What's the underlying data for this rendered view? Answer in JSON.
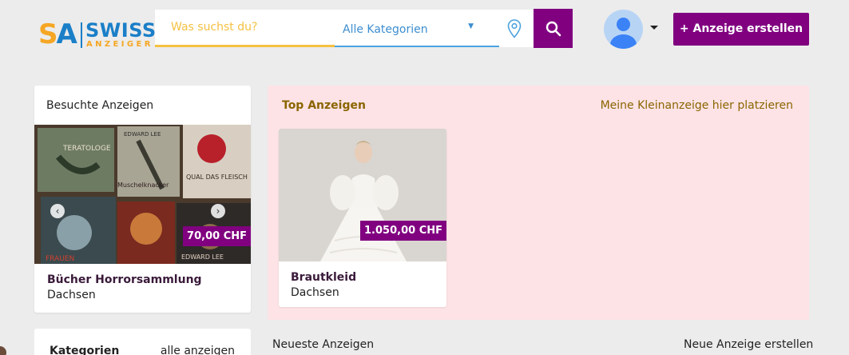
{
  "header": {
    "logo": {
      "sa": "SA",
      "swiss": "SWISS",
      "anzeiger": "ANZEIGER"
    },
    "search_placeholder": "Was suchst du?",
    "category_select": "Alle Kategorien",
    "create_button": "+ Anzeige erstellen"
  },
  "visited": {
    "title": "Besuchte Anzeigen",
    "item": {
      "price": "70,00 CHF",
      "title": "Bücher Horrorsammlung",
      "location": "Dachsen"
    },
    "books": [
      "TERATOLOGE",
      "EDWARD LEE",
      "QUAL DAS FLEISCH",
      "Muschelknacker",
      "FRAUEN",
      "EDWARD LEE"
    ]
  },
  "top_ads": {
    "title": "Top Anzeigen",
    "place_link": "Meine Kleinanzeige hier platzieren",
    "item": {
      "price": "1.050,00 CHF",
      "title": "Brautkleid",
      "location": "Dachsen"
    }
  },
  "categories": {
    "title": "Kategorien",
    "link": "alle anzeigen"
  },
  "newest": {
    "title": "Neueste Anzeigen",
    "link": "Neue Anzeige erstellen"
  },
  "colors": {
    "brand_purple": "#800080",
    "logo_blue": "#1b7fc8",
    "logo_orange": "#f5a623",
    "top_ads_bg": "#fde3e6"
  }
}
